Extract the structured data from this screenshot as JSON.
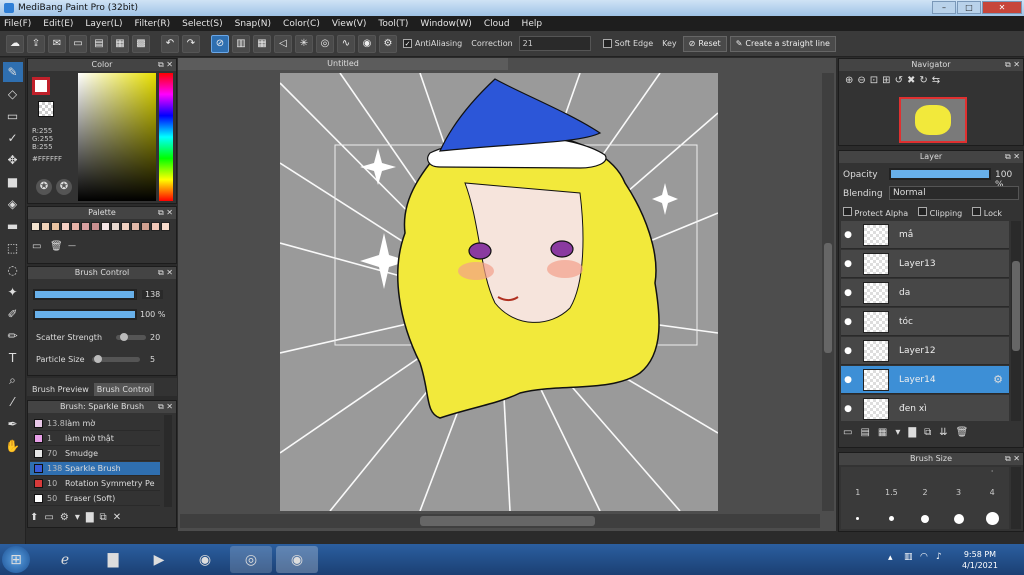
{
  "window": {
    "title": "MediBang Paint Pro (32bit)"
  },
  "menu": [
    "File(F)",
    "Edit(E)",
    "Layer(L)",
    "Filter(R)",
    "Select(S)",
    "Snap(N)",
    "Color(C)",
    "View(V)",
    "Tool(T)",
    "Window(W)",
    "Cloud",
    "Help"
  ],
  "toolbar": {
    "antialiasing_label": "AntiAliasing",
    "correction_label": "Correction",
    "correction_value": "21",
    "soft_edge_label": "Soft Edge",
    "key_label": "Key",
    "reset_label": "Reset",
    "straight_line_label": "Create a straight line"
  },
  "canvas": {
    "tab_title": "Untitled"
  },
  "color_panel": {
    "title": "Color",
    "r": "R:255",
    "g": "G:255",
    "b": "B:255",
    "hex": "#FFFFFF"
  },
  "palette_panel": {
    "title": "Palette",
    "swatches": [
      "#f3e3cf",
      "#f0d2b8",
      "#e8c2a0",
      "#f4cfc3",
      "#e8b4a8",
      "#d8a0a0",
      "#c98f8f",
      "#f4e6e6",
      "#e7d8cf",
      "#f0d0c0",
      "#e0b8a8",
      "#d0a090",
      "#f2c8b8",
      "#f8dccc"
    ]
  },
  "brush_control": {
    "title": "Brush Control",
    "size_value": "138",
    "opacity_value": "100 %",
    "scatter_label": "Scatter Strength",
    "scatter_value": "20",
    "particle_label": "Particle Size",
    "particle_value": "5",
    "tab_preview": "Brush Preview",
    "tab_control": "Brush Control",
    "size_fraction": 0.99,
    "opacity_fraction": 1.0,
    "scatter_fraction": 0.2,
    "particle_fraction": 0.05
  },
  "brush_list": {
    "title": "Brush: Sparkle Brush",
    "items": [
      {
        "val": "13.8",
        "name": "làm mờ",
        "color": "#e8c8e8"
      },
      {
        "val": "1",
        "name": "làm mờ thật",
        "color": "#e8a0e8"
      },
      {
        "val": "70",
        "name": "Smudge",
        "color": "#e6e6e6"
      },
      {
        "val": "138",
        "name": "Sparkle Brush",
        "color": "#3a5bd8",
        "selected": true
      },
      {
        "val": "10",
        "name": "Rotation Symmetry Pe",
        "color": "#d83a3a"
      },
      {
        "val": "50",
        "name": "Eraser (Soft)",
        "color": "#ffffff"
      }
    ]
  },
  "navigator": {
    "title": "Navigator"
  },
  "layer_panel": {
    "title": "Layer",
    "opacity_label": "Opacity",
    "opacity_value": "100 %",
    "opacity_fraction": 1.0,
    "blending_label": "Blending",
    "blending_value": "Normal",
    "protect_alpha": "Protect Alpha",
    "clipping": "Clipping",
    "lock": "Lock",
    "layers": [
      {
        "name": "mắ"
      },
      {
        "name": "Layer13"
      },
      {
        "name": "da"
      },
      {
        "name": "tóc"
      },
      {
        "name": "Layer12"
      },
      {
        "name": "Layer14",
        "selected": true
      },
      {
        "name": "đen xì"
      }
    ]
  },
  "brush_size_panel": {
    "title": "Brush Size",
    "sizes": [
      "1",
      "1.5",
      "2",
      "3",
      "4"
    ]
  },
  "taskbar": {
    "time": "9:58 PM",
    "date": "4/1/2021"
  }
}
